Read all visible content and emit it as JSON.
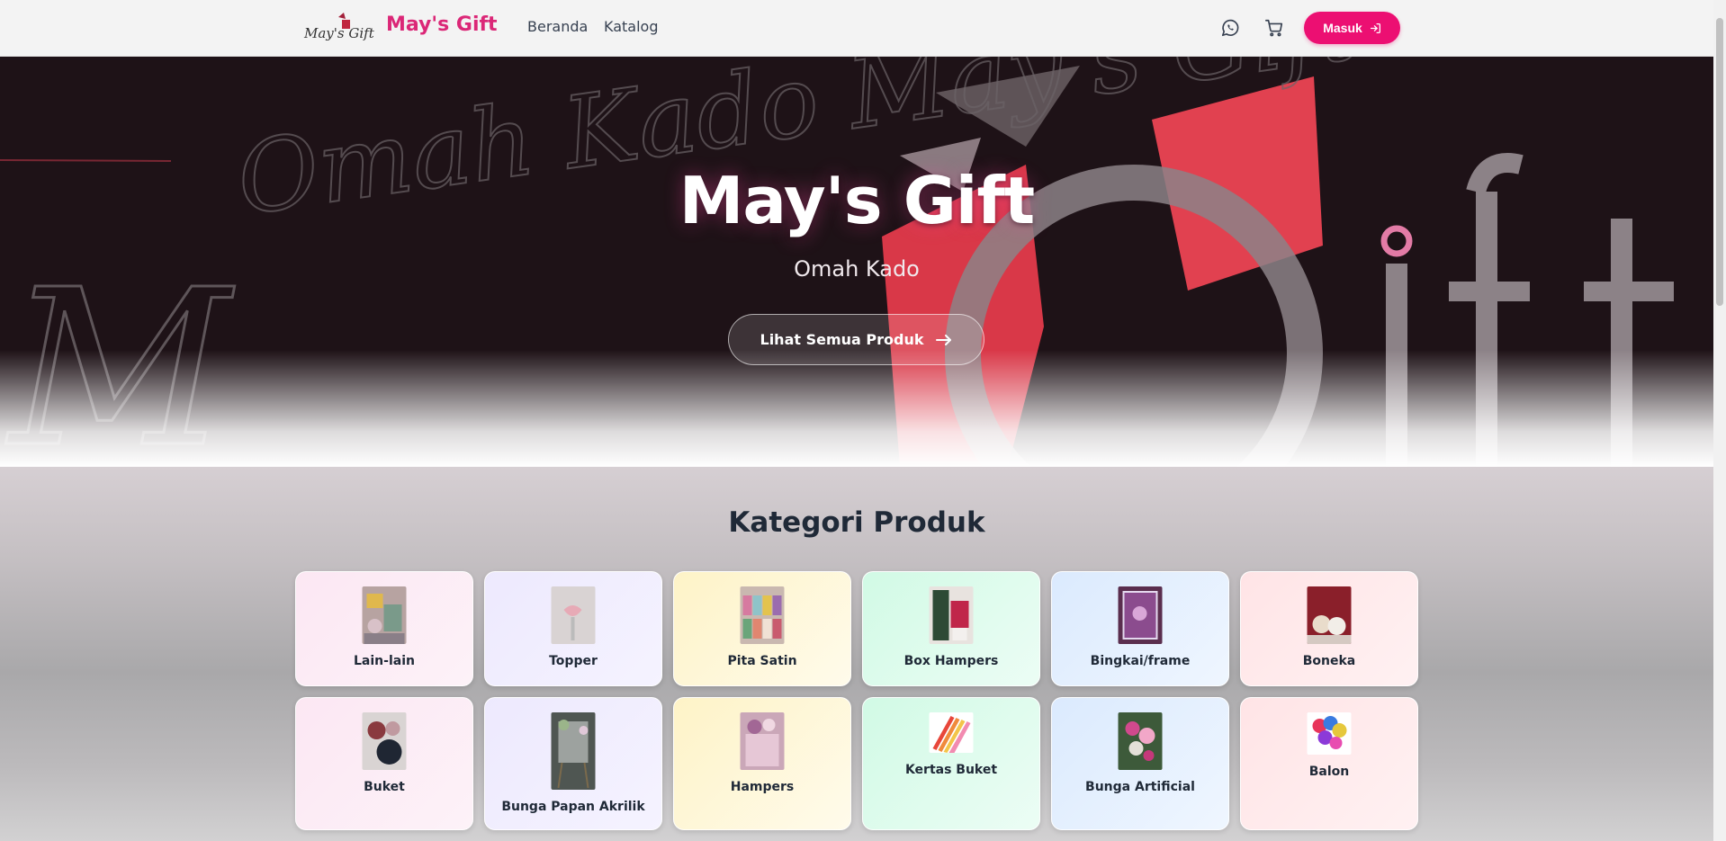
{
  "nav": {
    "logo_text": "May's Gift",
    "brand": "May's Gift",
    "links": [
      "Beranda",
      "Katalog"
    ],
    "login_label": "Masuk"
  },
  "hero": {
    "background_text": "Omah Kado May's Gift",
    "title": "May's Gift",
    "subtitle": "Omah Kado",
    "cta_label": "Lihat Semua Produk"
  },
  "categories": {
    "title": "Kategori Produk",
    "items": [
      {
        "label": "Lain-lain",
        "color": "#fce7f3"
      },
      {
        "label": "Topper",
        "color": "#ede9fe"
      },
      {
        "label": "Pita Satin",
        "color": "#fef3c7"
      },
      {
        "label": "Box Hampers",
        "color": "#d1fae5"
      },
      {
        "label": "Bingkai/frame",
        "color": "#dbeafe"
      },
      {
        "label": "Boneka",
        "color": "#ffe4e6"
      },
      {
        "label": "Buket",
        "color": "#fce7f3"
      },
      {
        "label": "Bunga Papan Akrilik",
        "color": "#ede9fe"
      },
      {
        "label": "Hampers",
        "color": "#fef3c7"
      },
      {
        "label": "Kertas Buket",
        "color": "#d1fae5"
      },
      {
        "label": "Bunga Artificial",
        "color": "#dbeafe"
      },
      {
        "label": "Balon",
        "color": "#ffe4e6"
      }
    ]
  },
  "colors": {
    "brand_pink": "#db2777",
    "button_pink": "#ec0f72",
    "heading_dark": "#1f2937"
  }
}
